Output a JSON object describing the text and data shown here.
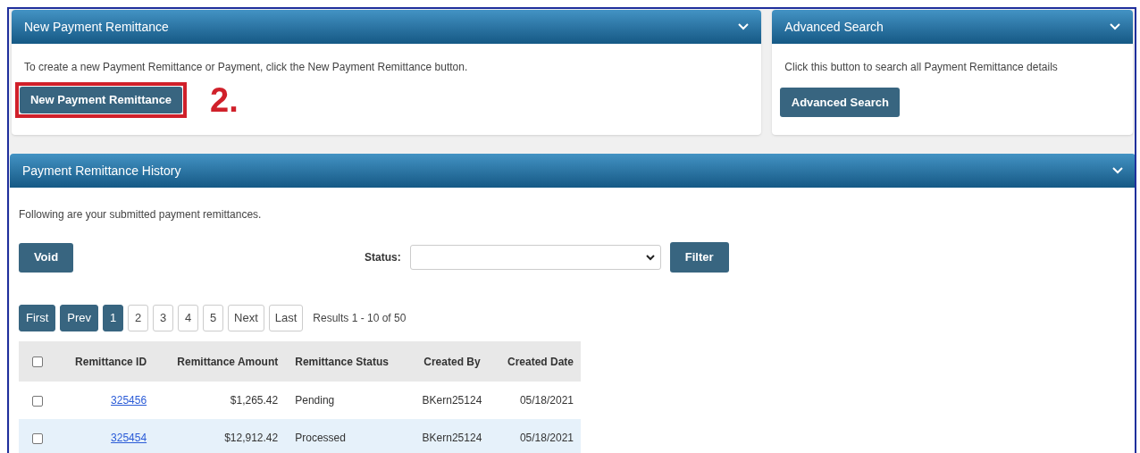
{
  "new_remittance_panel": {
    "title": "New Payment Remittance",
    "expanded": true,
    "description": "To create a new Payment Remittance or Payment, click the New Payment Remittance button.",
    "button": "New Payment Remittance",
    "annotation": "2."
  },
  "advanced_search_panel": {
    "title": "Advanced Search",
    "expanded": true,
    "description": "Click this button to search all Payment Remittance details",
    "button": "Advanced Search"
  },
  "history_panel": {
    "title": "Payment Remittance History",
    "expanded": true,
    "description": "Following are your submitted payment remittances.",
    "void_button": "Void",
    "status_label": "Status:",
    "filter_button": "Filter",
    "pagination": [
      {
        "label": "First",
        "kind": "nav"
      },
      {
        "label": "Prev",
        "kind": "nav"
      },
      {
        "label": "1",
        "kind": "page",
        "selected": true
      },
      {
        "label": "2",
        "kind": "page",
        "selected": false
      },
      {
        "label": "3",
        "kind": "page",
        "selected": false
      },
      {
        "label": "4",
        "kind": "page",
        "selected": false
      },
      {
        "label": "5",
        "kind": "page",
        "selected": false
      },
      {
        "label": "Next",
        "kind": "page",
        "selected": false
      },
      {
        "label": "Last",
        "kind": "page",
        "selected": false
      }
    ],
    "results": "Results 1 - 10 of 50",
    "table": {
      "all_checked": false,
      "columns": [
        "Remittance ID",
        "Remittance Amount",
        "Remittance Status",
        "Created By",
        "Created Date"
      ],
      "rows": [
        {
          "checked": false,
          "highlighted": false,
          "cells": [
            "325456",
            "$1,265.42",
            "Pending",
            "BKern25124",
            "05/18/2021"
          ]
        },
        {
          "checked": false,
          "highlighted": true,
          "cells": [
            "325454",
            "$12,912.42",
            "Processed",
            "BKern25124",
            "05/18/2021"
          ]
        }
      ]
    }
  }
}
